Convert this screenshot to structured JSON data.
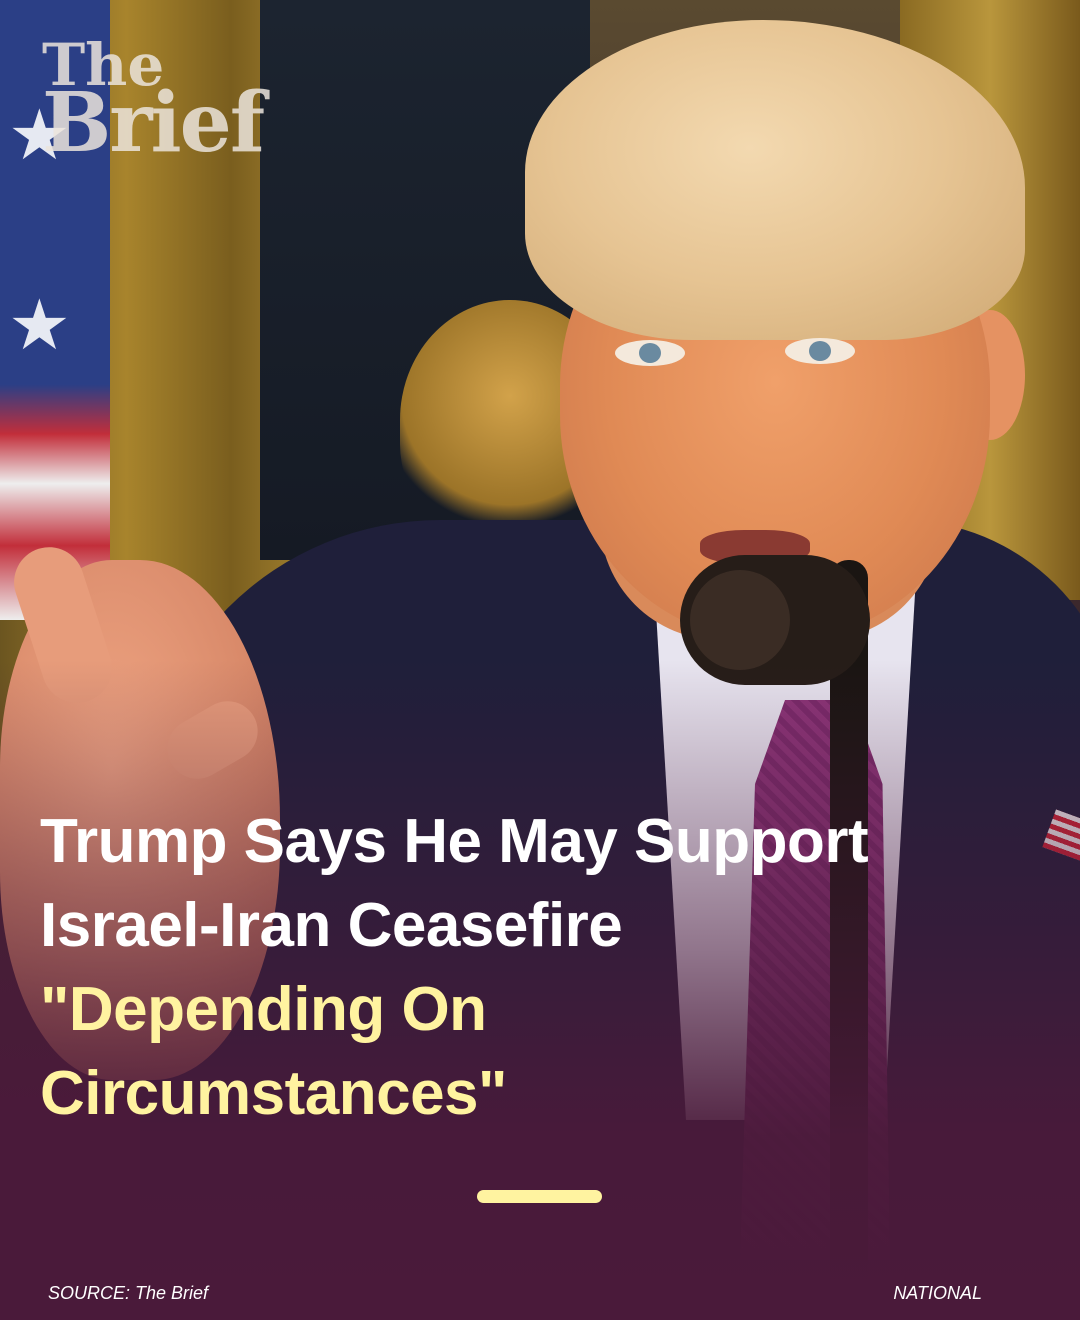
{
  "brand": {
    "line1": "The",
    "line2": "Brief"
  },
  "headline": {
    "line1": "Trump Says He May Support",
    "line2": "Israel-Iran Ceasefire",
    "line3": "\"Depending On",
    "line4": "Circumstances\""
  },
  "footer": {
    "source": "SOURCE: The Brief",
    "category": "NATIONAL"
  },
  "colors": {
    "background": "#4a1a3a",
    "headline_white": "#ffffff",
    "headline_accent": "#fff3a0",
    "divider": "#fff3a0"
  }
}
